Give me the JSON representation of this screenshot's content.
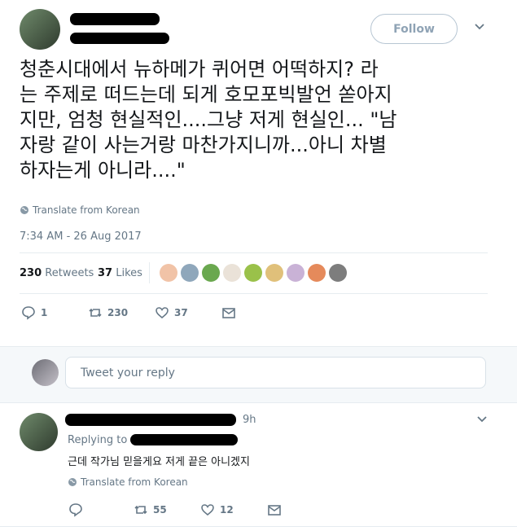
{
  "header": {
    "follow_label": "Follow"
  },
  "tweet": {
    "text": "청춘시대에서 뉴하메가 퀴어면 어떡하지? 라\n는 주제로 떠드는데 되게 호모포빅발언 쏟아지\n지만, 엄청 현실적인....그냥 저게 현실인... \"남\n자랑 같이 사는거랑 마찬가지니까...아니 차별\n하자는게 아니라....\"",
    "translate": "Translate from Korean",
    "timestamp": "7:34 AM - 26 Aug 2017",
    "retweets_count": "230",
    "retweets_label": "Retweets",
    "likes_count": "37",
    "likes_label": "Likes",
    "actions": {
      "reply_count": "1",
      "retweet_count": "230",
      "like_count": "37"
    }
  },
  "reply_box": {
    "placeholder": "Tweet your reply"
  },
  "reply": {
    "time": "9h",
    "replying_to": "Replying to",
    "text": "근데 작가님 믿을게요 저게 끝은 아니겠지",
    "translate": "Translate from Korean",
    "actions": {
      "retweet_count": "55",
      "like_count": "12"
    }
  },
  "colors": {
    "accent": "#1da1f2",
    "grey": "#657786",
    "border": "#e6ecf0"
  }
}
